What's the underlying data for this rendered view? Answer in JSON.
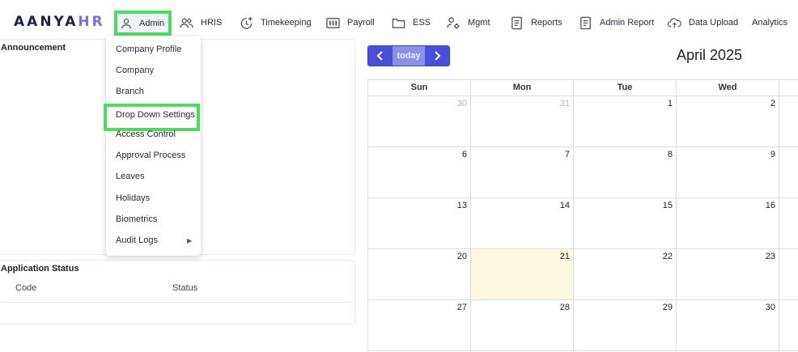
{
  "brand": {
    "name_main": "AANYA",
    "name_accent": "HR"
  },
  "nav": [
    {
      "id": "admin",
      "label": "Admin",
      "icon": "user-icon"
    },
    {
      "id": "hris",
      "label": "HRIS",
      "icon": "users-icon"
    },
    {
      "id": "timekeeping",
      "label": "Timekeeping",
      "icon": "clock-plus-icon"
    },
    {
      "id": "payroll",
      "label": "Payroll",
      "icon": "calculator-icon"
    },
    {
      "id": "ess",
      "label": "ESS",
      "icon": "folder-icon"
    },
    {
      "id": "mgmt",
      "label": "Mgmt",
      "icon": "user-gear-icon"
    },
    {
      "id": "reports",
      "label": "Reports",
      "icon": "document-icon"
    },
    {
      "id": "admin-report",
      "label": "Admin Report",
      "icon": "document-icon"
    },
    {
      "id": "data-upload",
      "label": "Data Upload",
      "icon": "cloud-upload-icon"
    },
    {
      "id": "analytics",
      "label": "Analytics",
      "icon": ""
    }
  ],
  "admin_menu": [
    {
      "label": "Company Profile"
    },
    {
      "label": "Company"
    },
    {
      "label": "Branch"
    },
    {
      "label": "Drop Down Settings",
      "highlighted": true
    },
    {
      "label": "Access Control"
    },
    {
      "label": "Approval Process"
    },
    {
      "label": "Leaves"
    },
    {
      "label": "Holidays"
    },
    {
      "label": "Biometrics"
    },
    {
      "label": "Audit Logs",
      "has_submenu": true
    }
  ],
  "announcement": {
    "title": "Announcement"
  },
  "application_status": {
    "title": "Application Status",
    "columns": [
      "Code",
      "Status"
    ]
  },
  "calendar": {
    "today_label": "today",
    "title": "April 2025",
    "weekdays": [
      "Sun",
      "Mon",
      "Tue",
      "Wed"
    ],
    "weeks": [
      [
        {
          "d": "30",
          "other": true
        },
        {
          "d": "31",
          "other": true
        },
        {
          "d": "1"
        },
        {
          "d": "2"
        }
      ],
      [
        {
          "d": "6"
        },
        {
          "d": "7"
        },
        {
          "d": "8"
        },
        {
          "d": "9"
        }
      ],
      [
        {
          "d": "13"
        },
        {
          "d": "14"
        },
        {
          "d": "15"
        },
        {
          "d": "16"
        }
      ],
      [
        {
          "d": "20"
        },
        {
          "d": "21",
          "today": true
        },
        {
          "d": "22"
        },
        {
          "d": "23"
        }
      ],
      [
        {
          "d": "27"
        },
        {
          "d": "28"
        },
        {
          "d": "29"
        },
        {
          "d": "30"
        }
      ]
    ]
  },
  "colors": {
    "highlight": "#4cd964",
    "primary": "#4a4fd8",
    "today_bg": "#fdf8e2"
  }
}
